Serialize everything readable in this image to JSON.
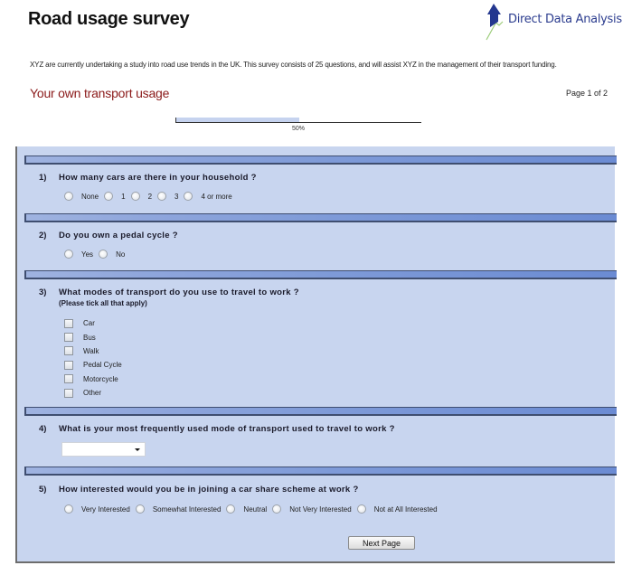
{
  "header": {
    "title": "Road usage survey",
    "logo_text": "Direct Data Analysis",
    "logo_icon": "upward-arrow-logo-icon",
    "intro": "XYZ are currently undertaking a study into road use trends in the UK. This survey consists of 25 questions, and will assist XYZ in the management of their transport funding.",
    "section_title": "Your own transport usage",
    "page_indicator": "Page 1 of 2"
  },
  "progress": {
    "percent": 50,
    "label": "50%"
  },
  "colors": {
    "section_title": "#8b1a1a",
    "panel_bg": "#c8d5ef",
    "separator": "#7f9bd8",
    "logo_text": "#2c3d8f"
  },
  "questions": [
    {
      "number": "1)",
      "text": "How many cars are there in your household ?",
      "type": "radio",
      "options": [
        "None",
        "1",
        "2",
        "3",
        "4 or more"
      ]
    },
    {
      "number": "2)",
      "text": "Do you own a pedal cycle ?",
      "type": "radio",
      "options": [
        "Yes",
        "No"
      ]
    },
    {
      "number": "3)",
      "text": "What modes of transport do you use to travel to work ?",
      "subtext": "(Please tick all that apply)",
      "type": "checkbox",
      "options": [
        "Car",
        "Bus",
        "Walk",
        "Pedal Cycle",
        "Motorcycle",
        "Other"
      ]
    },
    {
      "number": "4)",
      "text": "What is your most frequently used mode of transport used to travel to work ?",
      "type": "select",
      "selected": ""
    },
    {
      "number": "5)",
      "text": "How interested would you be in joining a car share scheme at work ?",
      "type": "radio",
      "options": [
        "Very Interested",
        "Somewhat Interested",
        "Neutral",
        "Not Very Interested",
        "Not at All Interested"
      ]
    }
  ],
  "footer": {
    "next_label": "Next Page"
  }
}
